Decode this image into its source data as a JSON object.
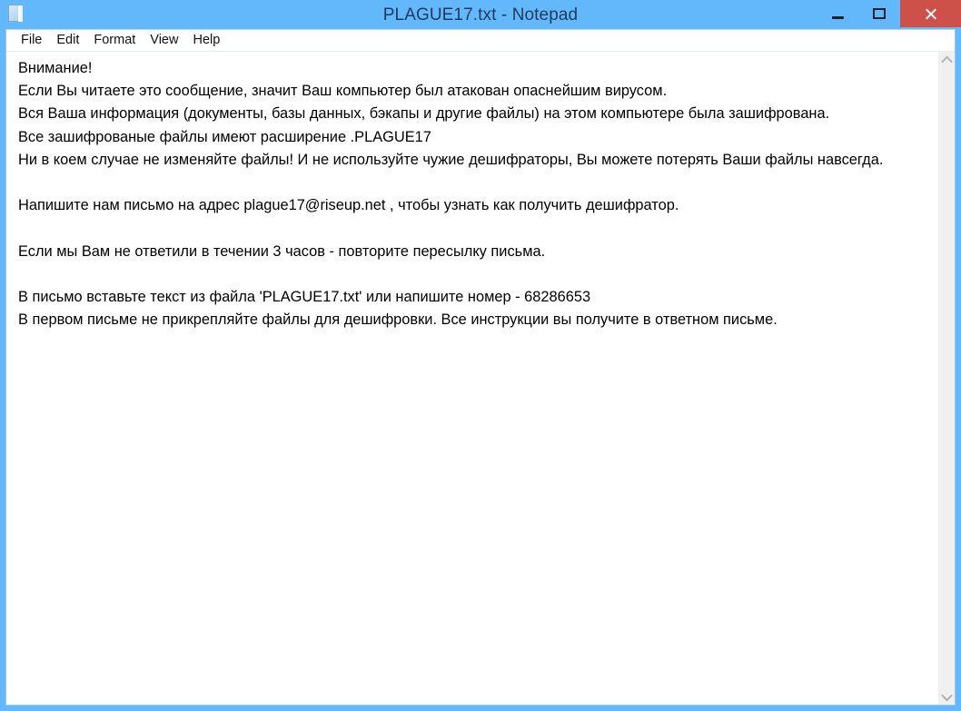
{
  "window": {
    "title": "PLAGUE17.txt - Notepad",
    "icon": "notepad-document-icon",
    "frame_color": "#63b8fb",
    "title_text_color": "#1f3a5f",
    "close_button_color": "#cd5049",
    "controls": {
      "minimize_label": "–",
      "maximize_label": "□",
      "close_label": "✕"
    }
  },
  "menubar": {
    "items": [
      {
        "label": "File"
      },
      {
        "label": "Edit"
      },
      {
        "label": "Format"
      },
      {
        "label": "View"
      },
      {
        "label": "Help"
      }
    ]
  },
  "document": {
    "filename": "PLAGUE17.txt",
    "contact_email": "plague17@riseup.net",
    "victim_id": "68286653",
    "extension": ".PLAGUE17",
    "response_hours": "3",
    "lines": [
      "Внимание!",
      "Если Вы читаете это сообщение, значит Ваш компьютер был атакован опаснейшим вирусом.",
      "Вся Ваша информация (документы, базы данных, бэкапы и другие файлы) на этом компьютере была зашифрована.",
      "Все зашифрованые файлы имеют расширение .PLAGUE17",
      "Ни в коем случае не изменяйте файлы! И не используйте чужие дешифраторы, Вы можете потерять Ваши файлы навсегда.",
      "",
      "Напишите нам письмо на адрес plague17@riseup.net , чтобы узнать как получить дешифратор.",
      "",
      "Если мы Вам не ответили в течении 3 часов - повторите пересылку письма.",
      "",
      "В письмо вставьте текст из файла 'PLAGUE17.txt' или напишите номер - 68286653",
      "В первом письме не прикрепляйте файлы для дешифровки. Все инструкции вы получите в ответном письме."
    ]
  },
  "scrollbar": {
    "up_arrow": "chevron-up-icon",
    "down_arrow": "chevron-down-icon"
  }
}
